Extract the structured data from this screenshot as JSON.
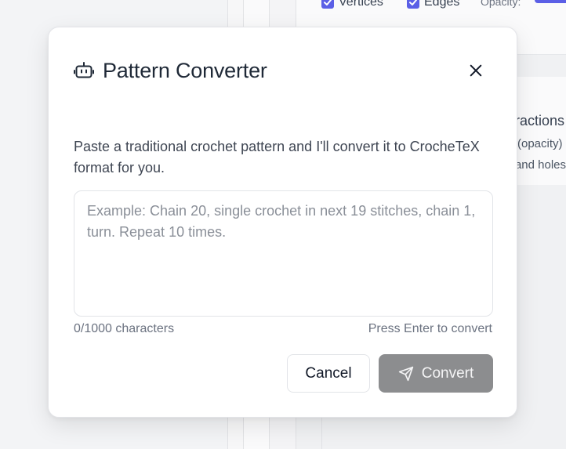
{
  "background": {
    "toolbar": {
      "checkbox_1_label": "Vertices",
      "checkbox_2_label": "Edges",
      "opacity_label": "Opacity:",
      "accent_color": "#5b5fe6"
    },
    "card": {
      "title": "Interactions",
      "line_1": "(opacity)",
      "line_2": "and holes"
    }
  },
  "modal": {
    "title": "Pattern Converter",
    "title_icon": "robot-icon",
    "close_icon": "close-icon",
    "description": "Paste a traditional crochet pattern and I'll convert it to CrocheTeX format for you.",
    "input": {
      "value": "",
      "placeholder": "Example: Chain 20, single crochet in next 19 stitches, chain 1, turn. Repeat 10 times."
    },
    "char_count": "0/1000 characters",
    "hint": "Press Enter to convert",
    "buttons": {
      "cancel_label": "Cancel",
      "convert_label": "Convert",
      "convert_icon": "send-icon",
      "convert_color": "#8c8d8f"
    }
  }
}
